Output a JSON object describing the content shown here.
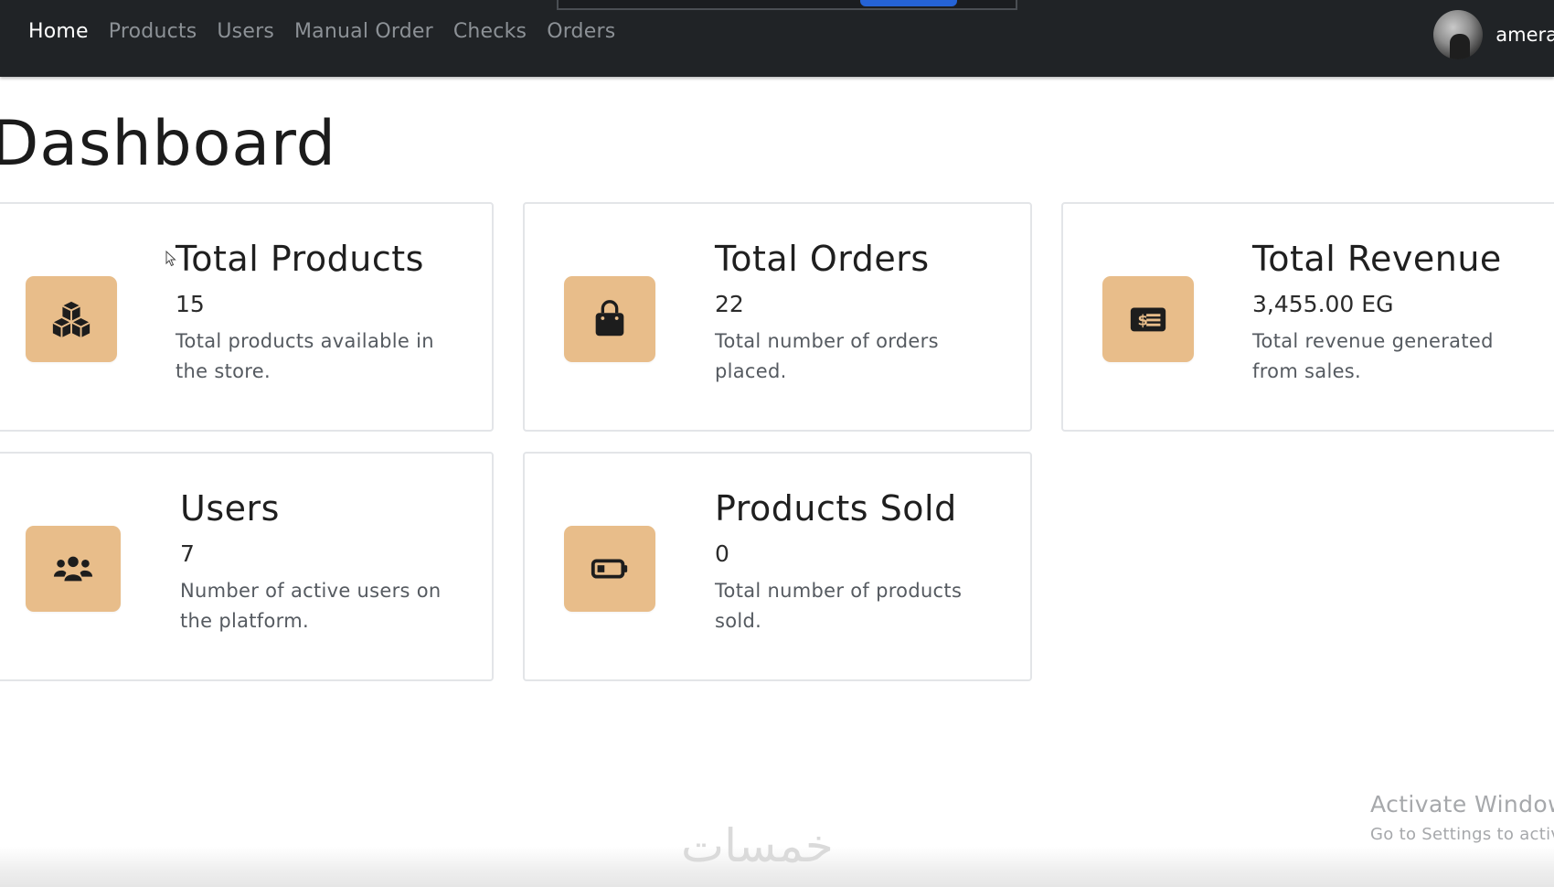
{
  "nav": {
    "links": [
      "Home",
      "Products",
      "Users",
      "Manual Order",
      "Checks",
      "Orders"
    ],
    "active_index": 0,
    "username": "amera"
  },
  "page": {
    "title": "Dashboard"
  },
  "cards": [
    {
      "title": "Total Products",
      "value": "15",
      "description": "Total products available in the store.",
      "icon": "cubes-icon"
    },
    {
      "title": "Total Orders",
      "value": "22",
      "description": "Total number of orders placed.",
      "icon": "shopping-bag-icon"
    },
    {
      "title": "Total Revenue",
      "value": "3,455.00 EG",
      "description": "Total revenue generated from sales.",
      "icon": "money-check-icon"
    },
    {
      "title": "Users",
      "value": "7",
      "description": "Number of active users on the platform.",
      "icon": "users-icon"
    },
    {
      "title": "Products Sold",
      "value": "0",
      "description": "Total number of products sold.",
      "icon": "battery-icon"
    }
  ],
  "watermark": {
    "activate_title": "Activate Window",
    "activate_sub": "Go to Settings to activa",
    "logo": "خمسات"
  },
  "colors": {
    "navbar_bg": "#202326",
    "icon_box_bg": "#e8bd8a",
    "active_link": "#ffffff",
    "inactive_link": "#8c9196"
  }
}
